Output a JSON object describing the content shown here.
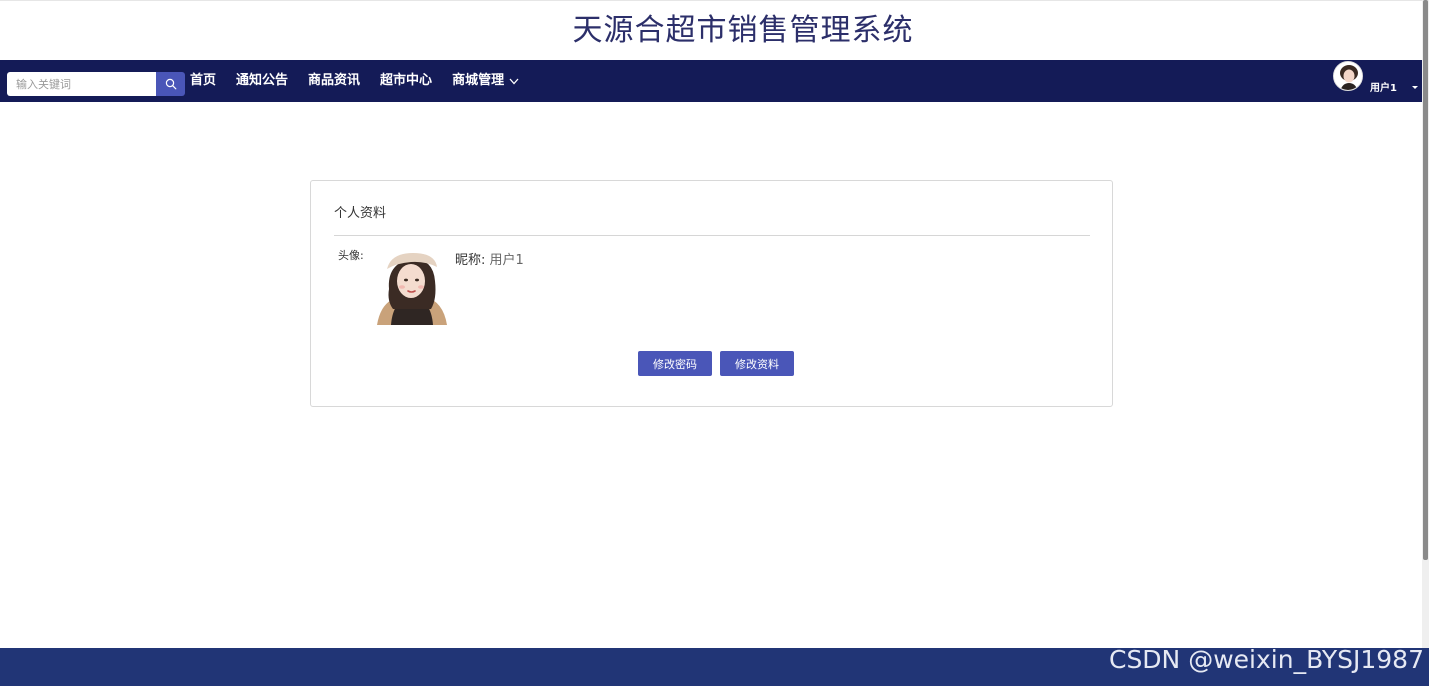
{
  "header": {
    "site_title": "天源合超市销售管理系统"
  },
  "navbar": {
    "search_placeholder": "输入关键词",
    "items": [
      {
        "label": "首页"
      },
      {
        "label": "通知公告"
      },
      {
        "label": "商品资讯"
      },
      {
        "label": "超市中心"
      },
      {
        "label": "商城管理",
        "has_dropdown": true
      }
    ],
    "user_name": "用户1",
    "icons": {
      "search": "search-icon",
      "dropdown": "chevron-down-icon",
      "user_menu": "caret-down-icon"
    }
  },
  "profile_card": {
    "title": "个人资料",
    "avatar_label": "头像:",
    "nickname_label": "昵称:",
    "nickname_value": "用户1",
    "buttons": {
      "change_password": "修改密码",
      "edit_profile": "修改资料"
    }
  },
  "watermark": "CSDN @weixin_BYSJ1987",
  "colors": {
    "navbar": "#141b57",
    "accent": "#4a56b8",
    "footer": "#213576",
    "title": "#2c2f6a"
  }
}
